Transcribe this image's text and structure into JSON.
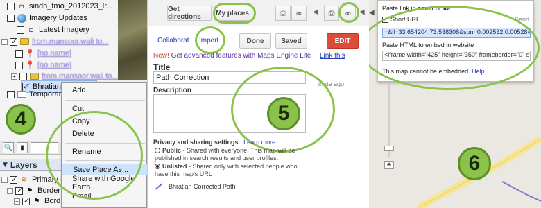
{
  "earth": {
    "tree": [
      {
        "label": "sindh_tmo_2012023_lr...",
        "checked": false
      },
      {
        "label": "Imagery Updates",
        "checked": false
      },
      {
        "label": "Latest Imagery",
        "checked": false
      },
      {
        "label": "from.mansoor.wali to...",
        "checked": true
      },
      {
        "label": "[no name]",
        "checked": false
      },
      {
        "label": "[no name]",
        "checked": false
      },
      {
        "label": "from.mansoor.wali to...",
        "checked": false
      },
      {
        "label": "Bhratian Corrected",
        "checked": true
      },
      {
        "label": "Temporar",
        "checked": false
      }
    ],
    "badge": "4",
    "layers_label": "Layers",
    "layers": [
      {
        "label": "Primary D"
      },
      {
        "label": "Border"
      },
      {
        "label": "Bord"
      }
    ],
    "context_menu": {
      "add": "Add",
      "cut": "Cut",
      "copy": "Copy",
      "delete": "Delete",
      "rename": "Rename",
      "save_place_as": "Save Place As...",
      "share": "Share with Google Earth",
      "email": "Email..."
    }
  },
  "maps": {
    "get_directions": "Get directions",
    "my_places": "My places",
    "collaborate": "Collaborat",
    "import": "Import",
    "done": "Done",
    "saved": "Saved",
    "edit": "EDIT",
    "new_label": "New!",
    "upsell": "Get advanced features with Maps Engine Lite",
    "link_encode": "Link this",
    "title_label": "Title",
    "title_value": "Path Correction",
    "description_label": "Description",
    "minute_ago": "inute ago",
    "privacy_label": "Privacy and sharing settings",
    "learn_more": "Learn more",
    "public_title": "Public",
    "public_desc": "- Shared with everyone. This map will be published in search results and user profiles.",
    "unlisted_title": "Unlisted",
    "unlisted_desc": "- Shared only with selected people who have this map's URL",
    "path_name": "Bhratian Corrected Path",
    "badge": "5"
  },
  "link": {
    "paste_label_pre": "Paste link in ",
    "paste_label_bold": "email or IM",
    "short_url": "Short URL",
    "send": "Send",
    "url_value": "=&ll=33.654204,73.538308&spn=0.002532,0.005284",
    "embed_label": "Paste HTML to embed in website",
    "embed_value": "<iframe width=\"425\" height=\"350\" frameborder=\"0\" s",
    "cannot_embed": "This map cannot be embedded.",
    "help": "Help",
    "badge": "6"
  },
  "colors": {
    "accent_green": "#8bc34a",
    "edit_red": "#dd4b39",
    "link_blue": "#2a3fb8"
  }
}
